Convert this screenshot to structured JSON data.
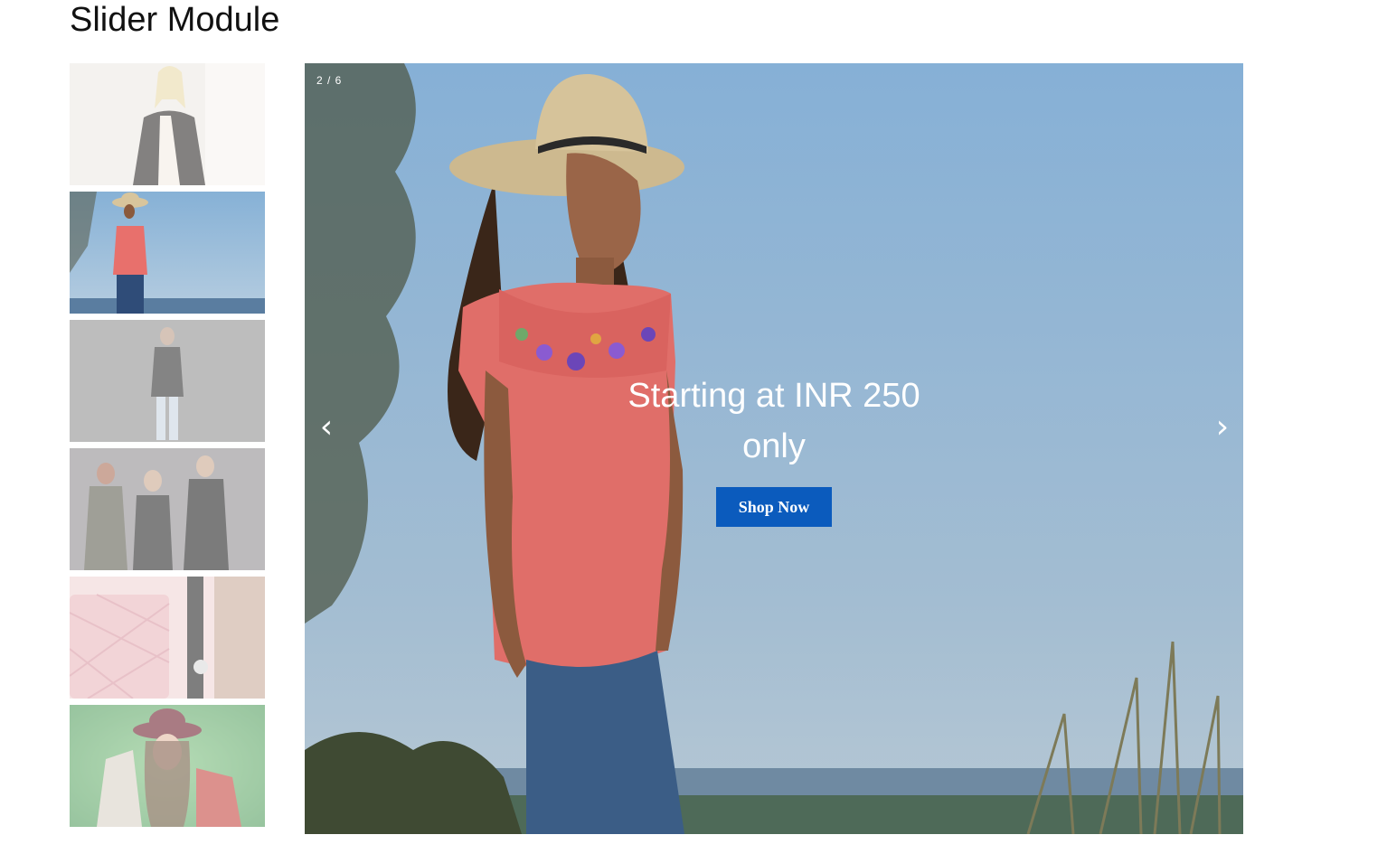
{
  "page": {
    "title": "Slider Module"
  },
  "slider": {
    "counter": "2 / 6",
    "caption": "Starting at INR 250 only",
    "cta_label": "Shop Now",
    "prev_label": "‹",
    "next_label": "›",
    "active_index": 2,
    "total": 6
  },
  "thumbnails": [
    {
      "name": "woman-blazer"
    },
    {
      "name": "woman-hat-coral-top",
      "active": true
    },
    {
      "name": "woman-black-jacket"
    },
    {
      "name": "three-women-group"
    },
    {
      "name": "quilted-handbag"
    },
    {
      "name": "woman-burgundy-hat"
    }
  ],
  "colors": {
    "cta": "#0b5bbd",
    "sky": "#8fb5d6",
    "coral_top": "#e8706c"
  }
}
